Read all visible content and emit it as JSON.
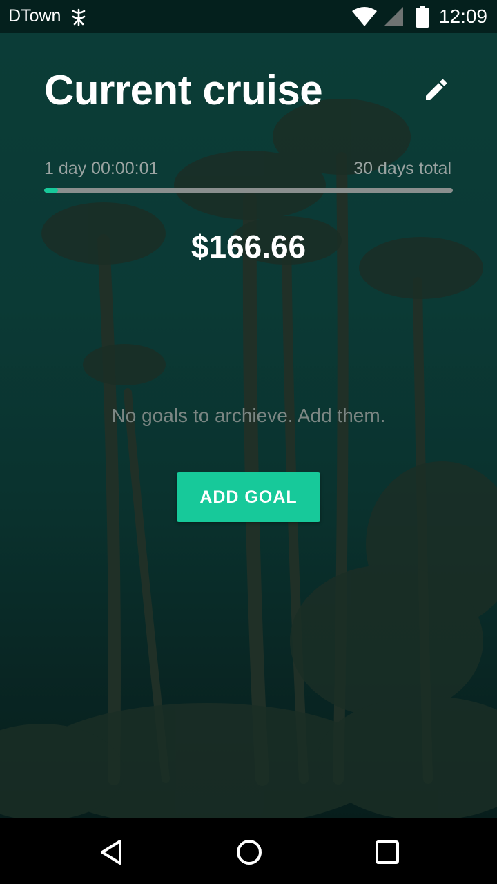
{
  "status_bar": {
    "carrier": "DTown",
    "carrier_icon": "signal-tower-icon",
    "wifi_icon": "wifi-icon",
    "cell_icon": "cell-signal-icon",
    "battery_icon": "battery-icon",
    "time": "12:09"
  },
  "header": {
    "title": "Current cruise",
    "edit_icon": "pencil-icon"
  },
  "progress": {
    "elapsed": "1 day 00:00:01",
    "total": "30 days total",
    "fraction": 0.0333,
    "accent_color": "#17c99a"
  },
  "amount": "$166.66",
  "goals": {
    "empty_message": "No goals to archieve. Add them.",
    "add_button_label": "ADD GOAL"
  },
  "nav_bar": {
    "back_icon": "back-triangle-icon",
    "home_icon": "home-circle-icon",
    "recents_icon": "recents-square-icon"
  }
}
